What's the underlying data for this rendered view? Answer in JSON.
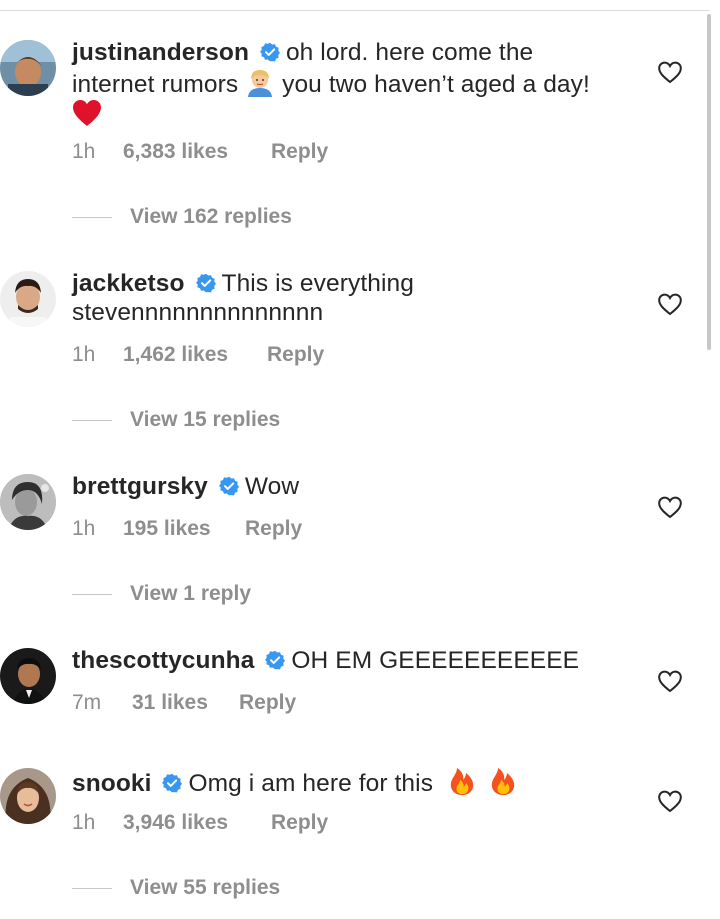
{
  "comments": [
    {
      "username": "justinanderson",
      "verified": true,
      "text_part1": "oh lord. here come the internet rumors",
      "text_part2": "you two haven’t aged a day!",
      "emoji1": "person-blond-emoji",
      "emoji2": "red-heart-emoji",
      "time": "1h",
      "likes": "6,383 likes",
      "reply": "Reply",
      "view_replies": "View 162 replies"
    },
    {
      "username": "jackketso",
      "verified": true,
      "text": "This is everything stevennnnnnnnnnnnnn",
      "time": "1h",
      "likes": "1,462 likes",
      "reply": "Reply",
      "view_replies": "View 15 replies"
    },
    {
      "username": "brettgursky",
      "verified": true,
      "text": "Wow",
      "time": "1h",
      "likes": "195 likes",
      "reply": "Reply",
      "view_replies": "View 1 reply"
    },
    {
      "username": "thescottycunha",
      "verified": true,
      "text": "OH EM GEEEEEEEEEEE",
      "time": "7m",
      "likes": "31 likes",
      "reply": "Reply"
    },
    {
      "username": "snooki",
      "verified": true,
      "text": "Omg i am here for this",
      "emoji": "fire-emoji",
      "time": "1h",
      "likes": "3,946 likes",
      "reply": "Reply",
      "view_replies": "View 55 replies"
    }
  ],
  "icons": {
    "verified": "verified-badge-icon",
    "like": "heart-outline-icon",
    "verified_color": "#3897f0",
    "heart_color": "#262626",
    "muted_color": "#8e8e8e"
  }
}
